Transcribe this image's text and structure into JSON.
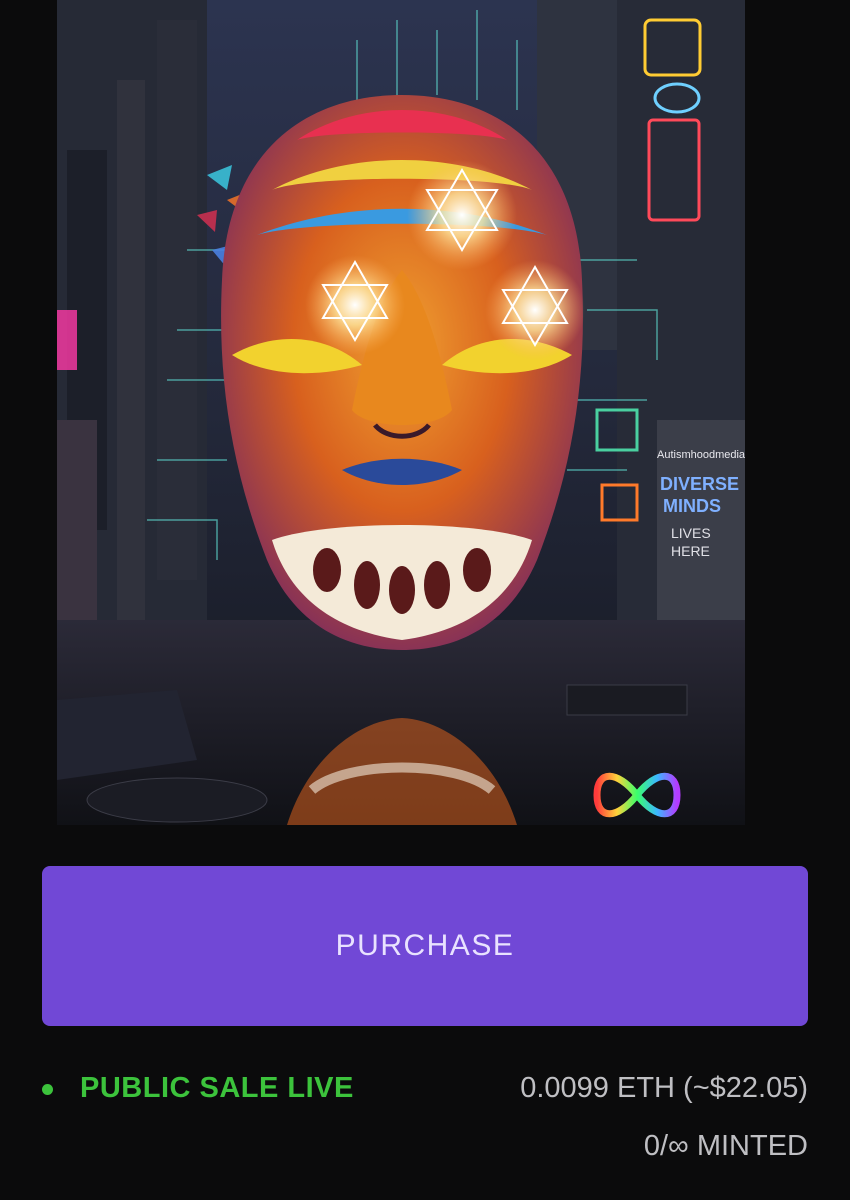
{
  "artwork": {
    "icon": "nft-artwork-image",
    "wall_text": {
      "handle": "Autismhoodmedia",
      "line1": "DIVERSE",
      "line2": "MINDS",
      "line3": "LIVES",
      "line4": "HERE"
    }
  },
  "purchase": {
    "label": "PURCHASE",
    "color": "#7148d6"
  },
  "status": {
    "label": "PUBLIC SALE LIVE",
    "color": "#3cc33c"
  },
  "price": {
    "label": "0.0099 ETH (~$22.05)"
  },
  "minted": {
    "label": "0/∞ MINTED"
  }
}
